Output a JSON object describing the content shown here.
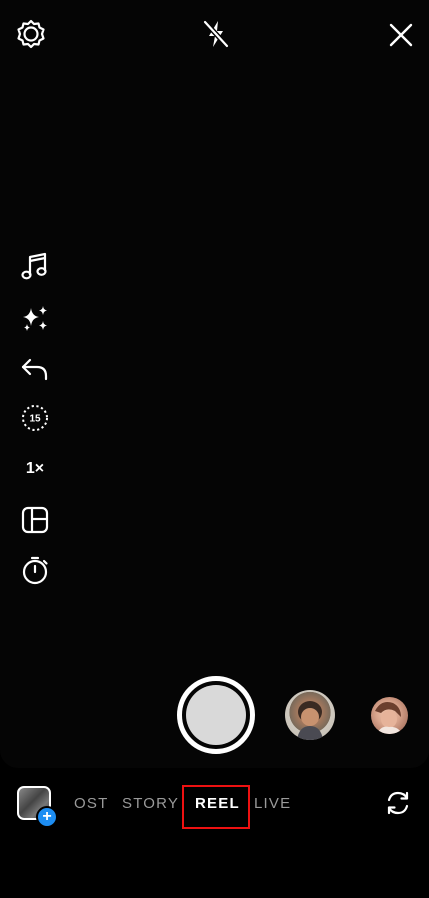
{
  "toolbar": {
    "settings_icon": "gear-icon",
    "flash_icon": "flash-off-icon",
    "close_icon": "close-icon"
  },
  "side_tools": {
    "items": [
      {
        "name": "audio",
        "icon": "music-note-icon"
      },
      {
        "name": "effects",
        "icon": "sparkles-icon"
      },
      {
        "name": "undo",
        "icon": "undo-icon"
      },
      {
        "name": "length",
        "icon": "timer-15-icon",
        "label": "15"
      },
      {
        "name": "speed",
        "icon": "speed-label",
        "label": "1×"
      },
      {
        "name": "layout",
        "icon": "layout-grid-icon"
      },
      {
        "name": "timer",
        "icon": "countdown-timer-icon"
      }
    ]
  },
  "modes": {
    "items": [
      "OST",
      "STORY",
      "REEL",
      "LIVE"
    ],
    "selected": "REEL"
  },
  "colors": {
    "background": "#000000",
    "accent_blue": "#1d8df2",
    "highlight_red": "#ee1111"
  }
}
